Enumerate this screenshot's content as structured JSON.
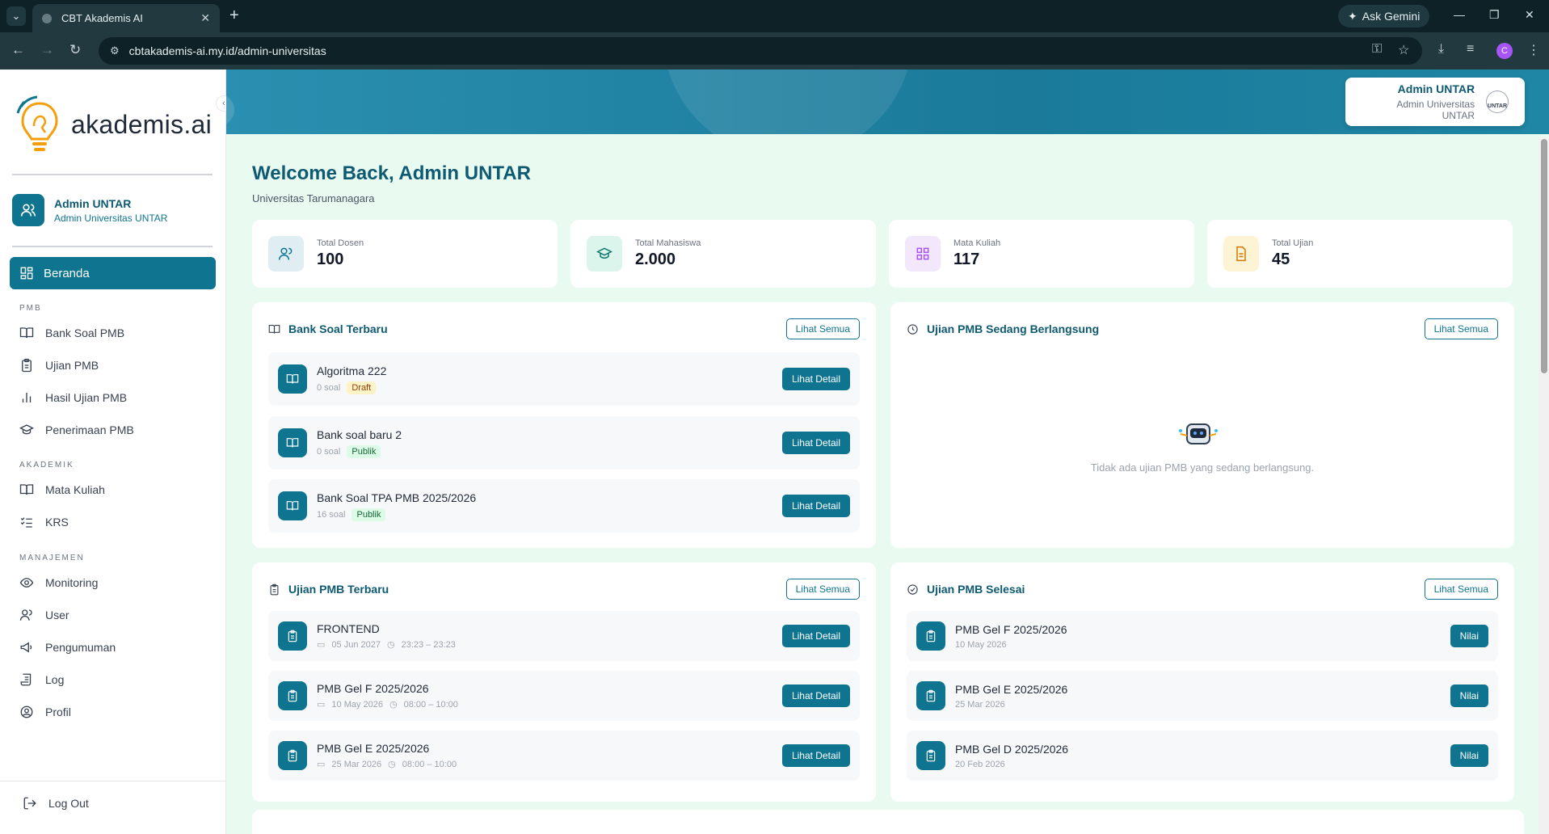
{
  "browser": {
    "tab_title": "CBT Akademis AI",
    "ask_gemini": "Ask Gemini",
    "url": "cbtakademis-ai.my.id/admin-universitas",
    "profile_initial": "C"
  },
  "sidebar": {
    "logo_text": "akademis.ai",
    "user_name": "Admin UNTAR",
    "user_role": "Admin Universitas UNTAR",
    "active_item": "Beranda",
    "sections": {
      "pmb": "PMB",
      "akademik": "AKADEMIK",
      "manajemen": "MANAJEMEN"
    },
    "items": {
      "bank_soal": "Bank Soal PMB",
      "ujian": "Ujian PMB",
      "hasil": "Hasil Ujian PMB",
      "penerimaan": "Penerimaan PMB",
      "mata_kuliah": "Mata Kuliah",
      "krs": "KRS",
      "monitoring": "Monitoring",
      "user": "User",
      "pengumuman": "Pengumuman",
      "log": "Log",
      "profil": "Profil"
    },
    "logout": "Log Out"
  },
  "header": {
    "name": "Admin UNTAR",
    "role": "Admin Universitas UNTAR",
    "logo_text": "UNTAR"
  },
  "main": {
    "welcome": "Welcome Back, Admin UNTAR",
    "university": "Universitas Tarumanagara",
    "stats": [
      {
        "label": "Total Dosen",
        "value": "100"
      },
      {
        "label": "Total Mahasiswa",
        "value": "2.000"
      },
      {
        "label": "Mata Kuliah",
        "value": "117"
      },
      {
        "label": "Total Ujian",
        "value": "45"
      }
    ],
    "see_all": "Lihat Semua",
    "detail": "Lihat Detail",
    "nilai": "Nilai",
    "bank_soal": {
      "title": "Bank Soal Terbaru",
      "items": [
        {
          "title": "Algoritma 222",
          "count": "0 soal",
          "status": "Draft"
        },
        {
          "title": "Bank soal baru 2",
          "count": "0 soal",
          "status": "Publik"
        },
        {
          "title": "Bank Soal TPA PMB 2025/2026",
          "count": "16 soal",
          "status": "Publik"
        }
      ]
    },
    "ongoing": {
      "title": "Ujian PMB Sedang Berlangsung",
      "empty": "Tidak ada ujian PMB yang sedang berlangsung."
    },
    "latest_exams": {
      "title": "Ujian PMB Terbaru",
      "items": [
        {
          "title": "FRONTEND",
          "date": "05 Jun 2027",
          "time": "23:23 – 23:23"
        },
        {
          "title": "PMB Gel F 2025/2026",
          "date": "10 May 2026",
          "time": "08:00 – 10:00"
        },
        {
          "title": "PMB Gel E 2025/2026",
          "date": "25 Mar 2026",
          "time": "08:00 – 10:00"
        }
      ]
    },
    "finished": {
      "title": "Ujian PMB Selesai",
      "items": [
        {
          "title": "PMB Gel F 2025/2026",
          "date": "10 May 2026"
        },
        {
          "title": "PMB Gel E 2025/2026",
          "date": "25 Mar 2026"
        },
        {
          "title": "PMB Gel D 2025/2026",
          "date": "20 Feb 2026"
        }
      ]
    }
  },
  "colors": {
    "primary": "#0e7490",
    "background": "#e9faf1"
  }
}
